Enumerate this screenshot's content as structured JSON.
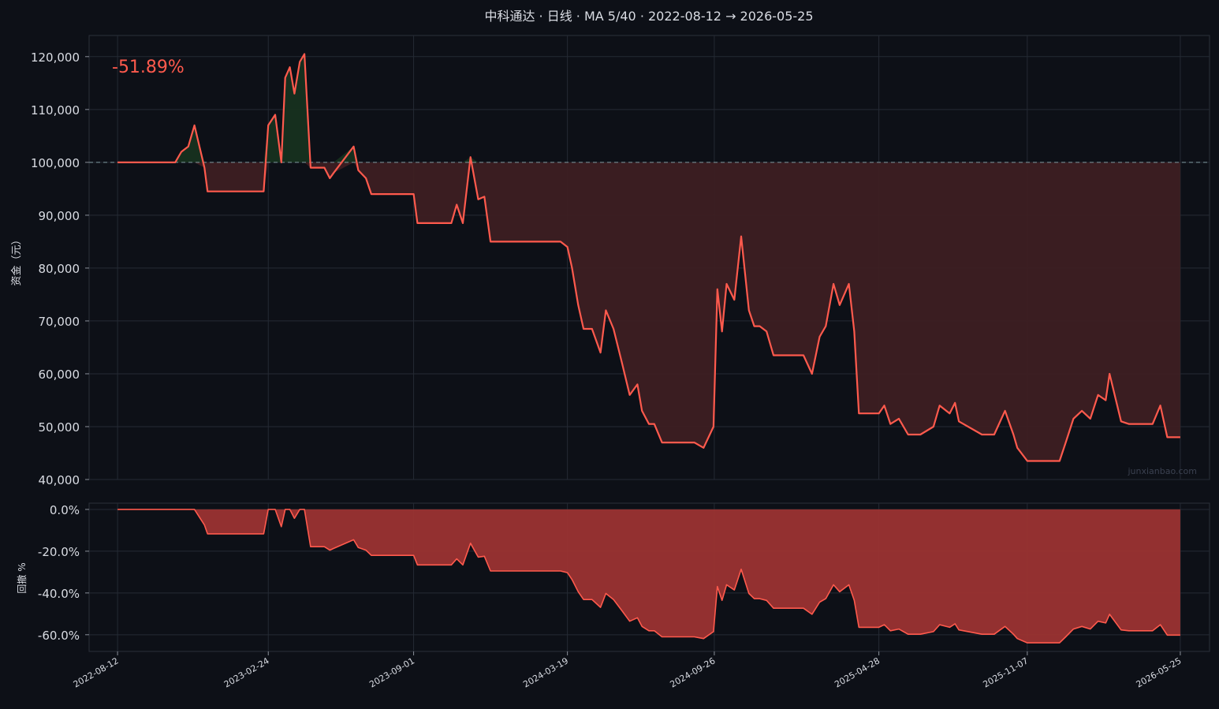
{
  "chart_data": [
    {
      "type": "area",
      "panel": "equity",
      "title": "中科通达 · 日线 · MA 5/40 · 2022-08-12 → 2026-05-25",
      "ylabel": "资金（元）",
      "ylim": [
        40000,
        124000
      ],
      "yticks": [
        40000,
        50000,
        60000,
        70000,
        80000,
        90000,
        100000,
        110000,
        120000
      ],
      "ytick_labels": [
        "40,000",
        "50,000",
        "60,000",
        "70,000",
        "80,000",
        "90,000",
        "100,000",
        "110,000",
        "120,000"
      ],
      "baseline": 100000,
      "annotation": "-51.89%",
      "watermark": "junxianbao.com",
      "grid": true,
      "x": [
        "2022-08-12",
        "2022-10-26",
        "2022-11-03",
        "2022-11-12",
        "2022-11-20",
        "2022-12-03",
        "2022-12-07",
        "2022-12-12",
        "2023-02-18",
        "2023-02-24",
        "2023-03-05",
        "2023-03-13",
        "2023-03-18",
        "2023-03-24",
        "2023-03-30",
        "2023-04-06",
        "2023-04-12",
        "2023-04-20",
        "2023-04-30",
        "2023-05-08",
        "2023-05-15",
        "2023-05-20",
        "2023-06-15",
        "2023-06-21",
        "2023-07-01",
        "2023-07-08",
        "2023-07-15",
        "2023-07-22",
        "2023-09-01",
        "2023-09-06",
        "2023-10-20",
        "2023-10-27",
        "2023-11-04",
        "2023-11-14",
        "2023-11-24",
        "2023-12-02",
        "2023-12-10",
        "2023-12-20",
        "2024-03-10",
        "2024-03-19",
        "2024-03-25",
        "2024-04-02",
        "2024-04-09",
        "2024-04-20",
        "2024-05-01",
        "2024-05-08",
        "2024-05-18",
        "2024-05-29",
        "2024-06-08",
        "2024-06-18",
        "2024-06-24",
        "2024-07-03",
        "2024-07-10",
        "2024-07-20",
        "2024-07-24",
        "2024-08-31",
        "2024-09-12",
        "2024-09-25",
        "2024-09-30",
        "2024-10-06",
        "2024-10-12",
        "2024-10-22",
        "2024-10-31",
        "2024-11-10",
        "2024-11-17",
        "2024-11-24",
        "2024-12-03",
        "2024-12-12",
        "2024-12-16",
        "2025-01-20",
        "2025-01-31",
        "2025-02-10",
        "2025-02-18",
        "2025-02-28",
        "2025-03-08",
        "2025-03-20",
        "2025-03-27",
        "2025-04-02",
        "2025-04-28",
        "2025-05-05",
        "2025-05-13",
        "2025-05-24",
        "2025-06-05",
        "2025-06-14",
        "2025-06-21",
        "2025-07-08",
        "2025-07-16",
        "2025-07-29",
        "2025-08-05",
        "2025-08-10",
        "2025-09-09",
        "2025-09-19",
        "2025-09-25",
        "2025-10-09",
        "2025-10-20",
        "2025-10-25",
        "2025-11-07",
        "2025-12-12",
        "2025-12-19",
        "2025-12-27",
        "2026-01-06",
        "2026-01-17",
        "2026-01-28",
        "2026-02-07",
        "2026-02-17",
        "2026-02-22",
        "2026-03-09",
        "2026-03-19",
        "2026-04-12",
        "2026-04-19",
        "2026-04-29",
        "2026-05-08",
        "2026-05-25"
      ],
      "series": [
        {
          "color": "#ff5a4d",
          "values": [
            100000,
            100000,
            102000,
            103000,
            107000,
            99000,
            94500,
            94500,
            94500,
            107000,
            109000,
            100000,
            116000,
            118000,
            113000,
            119000,
            120500,
            99000,
            99000,
            99000,
            97000,
            98000,
            103000,
            98500,
            97000,
            94000,
            94000,
            94000,
            94000,
            88500,
            88500,
            92000,
            88500,
            101000,
            93000,
            93500,
            85000,
            85000,
            85000,
            84000,
            80000,
            73000,
            68500,
            68500,
            64000,
            72000,
            68500,
            62000,
            56000,
            58000,
            53000,
            50500,
            50500,
            47000,
            47000,
            47000,
            46000,
            50000,
            76000,
            68000,
            77000,
            74000,
            86000,
            72000,
            69000,
            69000,
            68000,
            63500,
            63500,
            63500,
            60000,
            67000,
            69000,
            77000,
            73000,
            77000,
            68000,
            52500,
            52500,
            54000,
            50500,
            51500,
            48500,
            48500,
            48500,
            50000,
            54000,
            52500,
            54500,
            51000,
            48500,
            48500,
            48500,
            53000,
            48500,
            46000,
            43500,
            43500,
            43500,
            47000,
            51500,
            53000,
            51500,
            56000,
            55000,
            60000,
            51000,
            50500,
            50500,
            50500,
            54000,
            48000,
            48000
          ]
        }
      ]
    },
    {
      "type": "area",
      "panel": "drawdown",
      "ylabel": "回撤 %",
      "ylim": [
        -68,
        3
      ],
      "yticks": [
        0,
        -20,
        -40,
        -60
      ],
      "ytick_labels": [
        "0.0%",
        "-20.0%",
        "-40.0%",
        "-60.0%"
      ],
      "xticks": [
        "2022-08-12",
        "2023-02-24",
        "2023-09-01",
        "2024-03-19",
        "2024-09-26",
        "2025-04-28",
        "2025-11-07",
        "2026-05-25"
      ],
      "xlim": [
        "2022-07-06",
        "2026-07-02"
      ],
      "grid": true,
      "series": [
        {
          "color": "#ff5a4d",
          "fill": "#9b3331"
        }
      ]
    }
  ],
  "colors": {
    "background": "#0d1017",
    "line": "#ff5a4d",
    "loss_fill": "#3d1f22",
    "gain_fill": "#17311f",
    "drawdown_fill": "#9b3331",
    "baseline": "#7f9aa0",
    "grid": "#252a34",
    "text": "#d9dce3"
  }
}
